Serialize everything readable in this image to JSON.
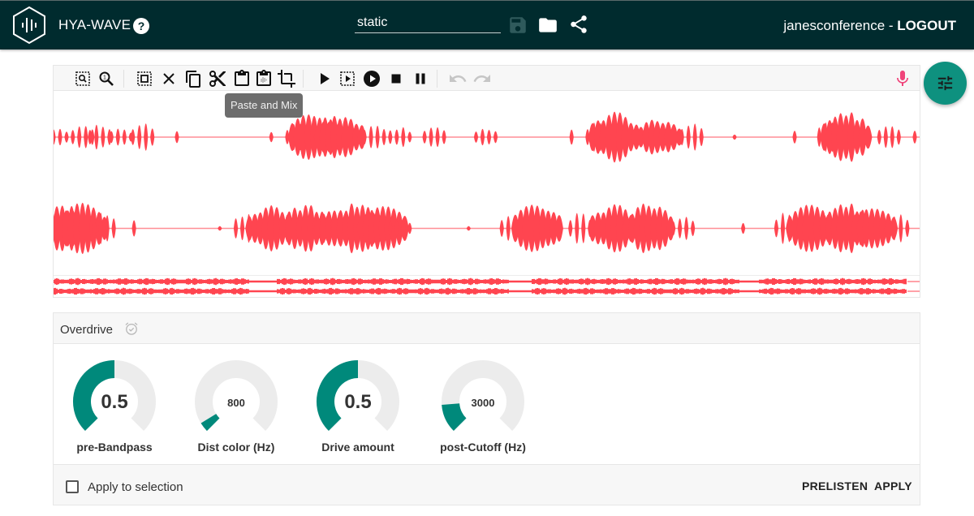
{
  "header": {
    "app_title": "HYA-WAVE",
    "help_icon": "help-circle-icon",
    "filename_value": "static",
    "icons": [
      "save-icon",
      "folder-open-icon",
      "share-icon"
    ],
    "username": "janesconference",
    "separator": " - ",
    "logout_label": "LOGOUT",
    "colors": {
      "background": "#002b2e",
      "save_icon_disabled": "#2f5a5c"
    }
  },
  "toolbar": {
    "groups": [
      [
        "zoom-selection-icon",
        "zoom-reset-icon"
      ],
      [
        "select-all-icon",
        "delete-icon",
        "copy-icon",
        "cut-icon",
        "paste-icon",
        "paste-mix-icon",
        "crop-icon"
      ],
      [
        "play-icon",
        "play-selection-icon",
        "loop-play-icon",
        "stop-icon",
        "pause-icon"
      ],
      [
        "undo-icon",
        "redo-icon"
      ]
    ],
    "tooltip": "Paste and Mix",
    "mic_icon": "microphone-icon",
    "mic_color": "#f0447a"
  },
  "waveform": {
    "color": "#ff4550",
    "tracks": [
      {
        "name": "track-1",
        "bursts": [
          [
            0.0,
            0.35
          ],
          [
            0.03,
            0.45
          ],
          [
            0.05,
            0.5
          ],
          [
            0.075,
            0.35
          ],
          [
            0.1,
            0.55
          ],
          [
            0.14,
            0.25
          ],
          [
            0.25,
            0.2
          ],
          [
            0.28,
            0.55
          ],
          [
            0.3,
            1.0
          ],
          [
            0.33,
            0.85
          ],
          [
            0.37,
            0.5
          ],
          [
            0.4,
            0.4
          ],
          [
            0.44,
            0.45
          ],
          [
            0.5,
            0.35
          ],
          [
            0.6,
            0.3
          ],
          [
            0.63,
            0.6
          ],
          [
            0.65,
            1.0
          ],
          [
            0.7,
            0.7
          ],
          [
            0.74,
            0.55
          ],
          [
            0.79,
            0.1
          ],
          [
            0.86,
            0.3
          ],
          [
            0.9,
            0.6
          ],
          [
            0.92,
            1.0
          ],
          [
            0.97,
            0.55
          ],
          [
            1.0,
            0.25
          ]
        ]
      },
      {
        "name": "track-2",
        "bursts": [
          [
            0.0,
            0.9
          ],
          [
            0.03,
            0.95
          ],
          [
            0.055,
            0.6
          ],
          [
            0.09,
            0.3
          ],
          [
            0.19,
            0.1
          ],
          [
            0.22,
            0.6
          ],
          [
            0.25,
            0.85
          ],
          [
            0.29,
            0.9
          ],
          [
            0.33,
            0.75
          ],
          [
            0.35,
            0.95
          ],
          [
            0.38,
            0.85
          ],
          [
            0.4,
            0.4
          ],
          [
            0.48,
            0.1
          ],
          [
            0.53,
            0.5
          ],
          [
            0.56,
            0.95
          ],
          [
            0.61,
            0.6
          ],
          [
            0.65,
            0.9
          ],
          [
            0.69,
            0.95
          ],
          [
            0.73,
            0.45
          ],
          [
            0.8,
            0.2
          ],
          [
            0.85,
            0.6
          ],
          [
            0.88,
            0.9
          ],
          [
            0.92,
            0.95
          ],
          [
            0.95,
            0.9
          ],
          [
            0.98,
            0.55
          ]
        ]
      },
      {
        "name": "track-3-stereo",
        "dense": true
      }
    ]
  },
  "fab": {
    "icon": "tune-sliders-icon",
    "color": "#0e917f"
  },
  "effect": {
    "title": "Overdrive",
    "status_icon": "alarm-check-icon",
    "knobs": [
      {
        "label": "pre-Bandpass",
        "value_text": "0.5",
        "fraction": 0.5,
        "size": "big"
      },
      {
        "label": "Dist color (Hz)",
        "value_text": "800",
        "fraction": 0.05,
        "size": "small"
      },
      {
        "label": "Drive amount",
        "value_text": "0.5",
        "fraction": 0.5,
        "size": "big"
      },
      {
        "label": "post-Cutoff (Hz)",
        "value_text": "3000",
        "fraction": 0.15,
        "size": "small"
      }
    ],
    "knob_fill_color": "#00897b",
    "knob_track_color": "#ececec",
    "apply_to_selection_label": "Apply to selection",
    "apply_to_selection_checked": false,
    "prelisten_label": "PRELISTEN",
    "apply_label": "APPLY"
  }
}
